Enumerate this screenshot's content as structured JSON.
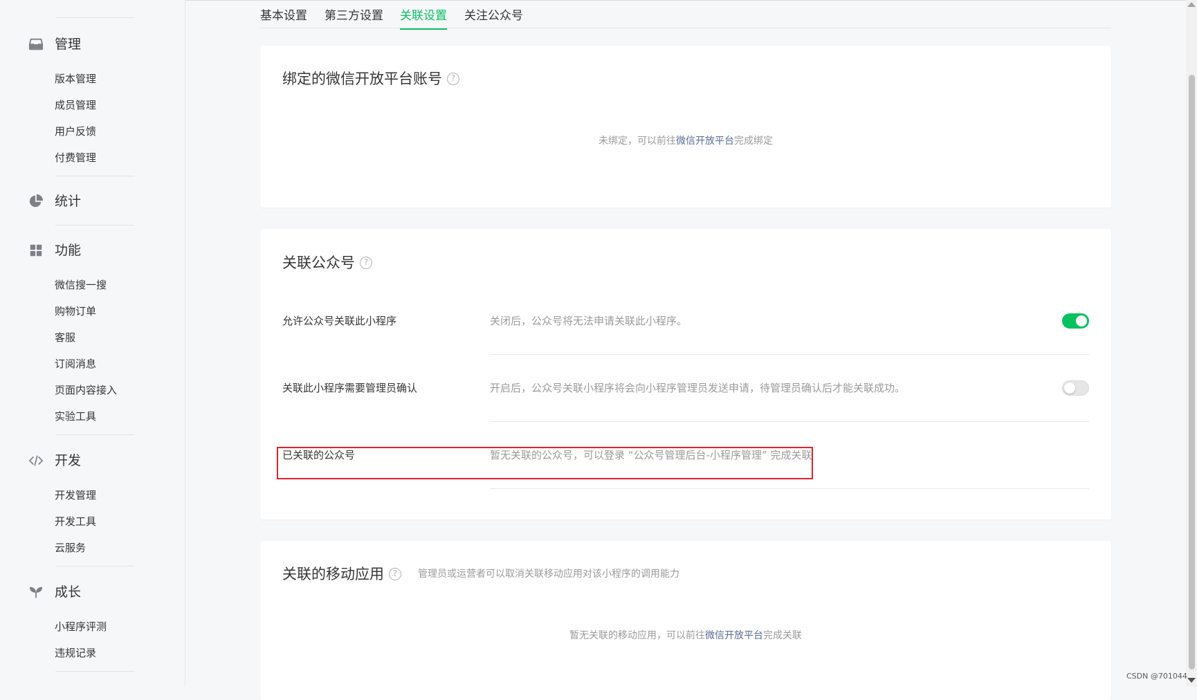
{
  "sidebar": {
    "groups": [
      {
        "title": "管理",
        "icon": "inbox-icon",
        "items": [
          "版本管理",
          "成员管理",
          "用户反馈",
          "付费管理"
        ]
      },
      {
        "title": "统计",
        "icon": "pie-chart-icon",
        "items": []
      },
      {
        "title": "功能",
        "icon": "grid-icon",
        "items": [
          "微信搜一搜",
          "购物订单",
          "客服",
          "订阅消息",
          "页面内容接入",
          "实验工具"
        ]
      },
      {
        "title": "开发",
        "icon": "code-icon",
        "items": [
          "开发管理",
          "开发工具",
          "云服务"
        ]
      },
      {
        "title": "成长",
        "icon": "sprout-icon",
        "items": [
          "小程序评测",
          "违规记录"
        ]
      }
    ]
  },
  "tabs": [
    {
      "label": "基本设置",
      "active": false
    },
    {
      "label": "第三方设置",
      "active": false
    },
    {
      "label": "关联设置",
      "active": true
    },
    {
      "label": "关注公众号",
      "active": false
    }
  ],
  "cards": {
    "open_platform": {
      "title": "绑定的微信开放平台账号",
      "empty_prefix": "未绑定，可以前往",
      "empty_link": "微信开放平台",
      "empty_suffix": "完成绑定"
    },
    "official_account": {
      "title": "关联公众号",
      "rows": [
        {
          "label": "允许公众号关联此小程序",
          "desc": "关闭后，公众号将无法申请关联此小程序。",
          "switch": true
        },
        {
          "label": "关联此小程序需要管理员确认",
          "desc": "开启后，公众号关联小程序将会向小程序管理员发送申请，待管理员确认后才能关联成功。",
          "switch": false
        },
        {
          "label": "已关联的公众号",
          "desc": "暂无关联的公众号，可以登录 “公众号管理后台-小程序管理” 完成关联",
          "switch": null
        }
      ]
    },
    "mobile_app": {
      "title": "关联的移动应用",
      "subtitle": "管理员或运营者可以取消关联移动应用对该小程序的调用能力",
      "empty_prefix": "暂无关联的移动应用，可以前往",
      "empty_link": "微信开放平台",
      "empty_suffix": "完成关联"
    }
  },
  "watermark": "CSDN @701044",
  "colors": {
    "accent": "#07c160",
    "link": "#576b95",
    "highlight": "#e0202a"
  }
}
